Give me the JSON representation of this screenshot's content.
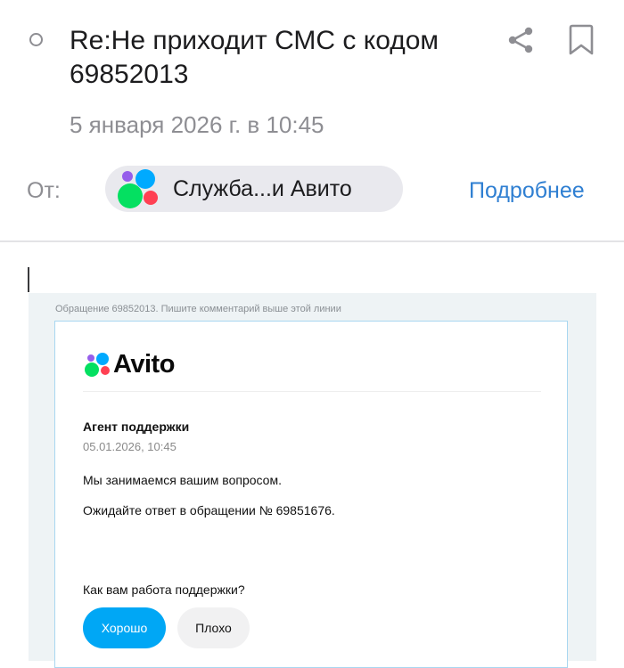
{
  "header": {
    "subject": "Re:Не приходит СМС с кодом 69852013",
    "date": "5 января 2026 г. в 10:45",
    "from_label": "От:",
    "sender_name": "Служба...и Авито",
    "details_link": "Подробнее",
    "icons": [
      "unread-dot-icon",
      "share-icon",
      "bookmark-icon"
    ]
  },
  "email": {
    "ticket_note": "Обращение 69852013. Пишите комментарий выше этой линии",
    "logo_text": "Avito",
    "agent_name": "Агент поддержки",
    "agent_date": "05.01.2026, 10:45",
    "message_line_1": "Мы занимаемся вашим вопросом.",
    "message_line_2": "Ожидайте ответ в обращении № 69851676.",
    "rating_question": "Как вам работа поддержки?",
    "good_button": "Хорошо",
    "bad_button": "Плохо"
  },
  "colors": {
    "link": "#2f7fd2",
    "primary_button": "#00a7f5",
    "secondary_button": "#f1f1f2",
    "frame_background": "#eef3f5",
    "card_border": "#a9d7f0",
    "logo_dots": [
      "#965eeb",
      "#04e061",
      "#0af",
      "#ff4053"
    ]
  }
}
